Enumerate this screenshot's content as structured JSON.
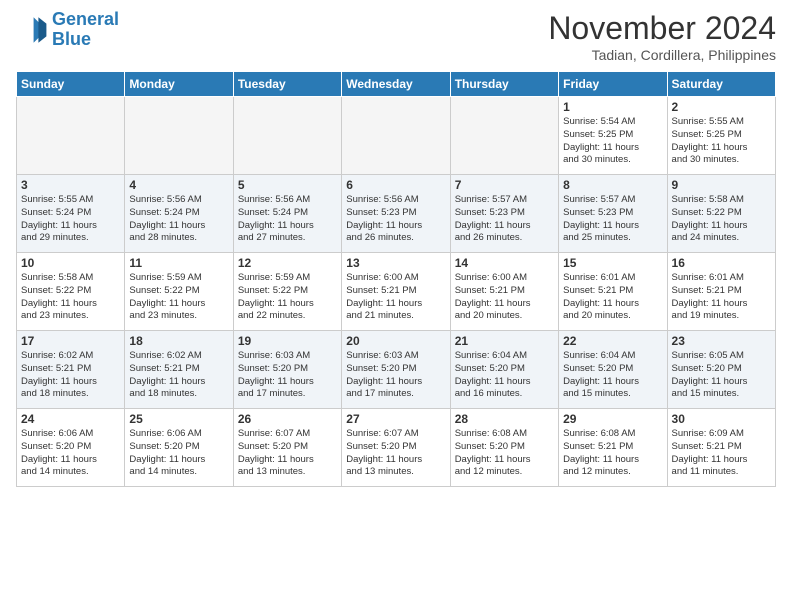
{
  "logo": {
    "line1": "General",
    "line2": "Blue"
  },
  "title": "November 2024",
  "location": "Tadian, Cordillera, Philippines",
  "weekdays": [
    "Sunday",
    "Monday",
    "Tuesday",
    "Wednesday",
    "Thursday",
    "Friday",
    "Saturday"
  ],
  "weeks": [
    [
      {
        "day": "",
        "info": ""
      },
      {
        "day": "",
        "info": ""
      },
      {
        "day": "",
        "info": ""
      },
      {
        "day": "",
        "info": ""
      },
      {
        "day": "",
        "info": ""
      },
      {
        "day": "1",
        "info": "Sunrise: 5:54 AM\nSunset: 5:25 PM\nDaylight: 11 hours\nand 30 minutes."
      },
      {
        "day": "2",
        "info": "Sunrise: 5:55 AM\nSunset: 5:25 PM\nDaylight: 11 hours\nand 30 minutes."
      }
    ],
    [
      {
        "day": "3",
        "info": "Sunrise: 5:55 AM\nSunset: 5:24 PM\nDaylight: 11 hours\nand 29 minutes."
      },
      {
        "day": "4",
        "info": "Sunrise: 5:56 AM\nSunset: 5:24 PM\nDaylight: 11 hours\nand 28 minutes."
      },
      {
        "day": "5",
        "info": "Sunrise: 5:56 AM\nSunset: 5:24 PM\nDaylight: 11 hours\nand 27 minutes."
      },
      {
        "day": "6",
        "info": "Sunrise: 5:56 AM\nSunset: 5:23 PM\nDaylight: 11 hours\nand 26 minutes."
      },
      {
        "day": "7",
        "info": "Sunrise: 5:57 AM\nSunset: 5:23 PM\nDaylight: 11 hours\nand 26 minutes."
      },
      {
        "day": "8",
        "info": "Sunrise: 5:57 AM\nSunset: 5:23 PM\nDaylight: 11 hours\nand 25 minutes."
      },
      {
        "day": "9",
        "info": "Sunrise: 5:58 AM\nSunset: 5:22 PM\nDaylight: 11 hours\nand 24 minutes."
      }
    ],
    [
      {
        "day": "10",
        "info": "Sunrise: 5:58 AM\nSunset: 5:22 PM\nDaylight: 11 hours\nand 23 minutes."
      },
      {
        "day": "11",
        "info": "Sunrise: 5:59 AM\nSunset: 5:22 PM\nDaylight: 11 hours\nand 23 minutes."
      },
      {
        "day": "12",
        "info": "Sunrise: 5:59 AM\nSunset: 5:22 PM\nDaylight: 11 hours\nand 22 minutes."
      },
      {
        "day": "13",
        "info": "Sunrise: 6:00 AM\nSunset: 5:21 PM\nDaylight: 11 hours\nand 21 minutes."
      },
      {
        "day": "14",
        "info": "Sunrise: 6:00 AM\nSunset: 5:21 PM\nDaylight: 11 hours\nand 20 minutes."
      },
      {
        "day": "15",
        "info": "Sunrise: 6:01 AM\nSunset: 5:21 PM\nDaylight: 11 hours\nand 20 minutes."
      },
      {
        "day": "16",
        "info": "Sunrise: 6:01 AM\nSunset: 5:21 PM\nDaylight: 11 hours\nand 19 minutes."
      }
    ],
    [
      {
        "day": "17",
        "info": "Sunrise: 6:02 AM\nSunset: 5:21 PM\nDaylight: 11 hours\nand 18 minutes."
      },
      {
        "day": "18",
        "info": "Sunrise: 6:02 AM\nSunset: 5:21 PM\nDaylight: 11 hours\nand 18 minutes."
      },
      {
        "day": "19",
        "info": "Sunrise: 6:03 AM\nSunset: 5:20 PM\nDaylight: 11 hours\nand 17 minutes."
      },
      {
        "day": "20",
        "info": "Sunrise: 6:03 AM\nSunset: 5:20 PM\nDaylight: 11 hours\nand 17 minutes."
      },
      {
        "day": "21",
        "info": "Sunrise: 6:04 AM\nSunset: 5:20 PM\nDaylight: 11 hours\nand 16 minutes."
      },
      {
        "day": "22",
        "info": "Sunrise: 6:04 AM\nSunset: 5:20 PM\nDaylight: 11 hours\nand 15 minutes."
      },
      {
        "day": "23",
        "info": "Sunrise: 6:05 AM\nSunset: 5:20 PM\nDaylight: 11 hours\nand 15 minutes."
      }
    ],
    [
      {
        "day": "24",
        "info": "Sunrise: 6:06 AM\nSunset: 5:20 PM\nDaylight: 11 hours\nand 14 minutes."
      },
      {
        "day": "25",
        "info": "Sunrise: 6:06 AM\nSunset: 5:20 PM\nDaylight: 11 hours\nand 14 minutes."
      },
      {
        "day": "26",
        "info": "Sunrise: 6:07 AM\nSunset: 5:20 PM\nDaylight: 11 hours\nand 13 minutes."
      },
      {
        "day": "27",
        "info": "Sunrise: 6:07 AM\nSunset: 5:20 PM\nDaylight: 11 hours\nand 13 minutes."
      },
      {
        "day": "28",
        "info": "Sunrise: 6:08 AM\nSunset: 5:20 PM\nDaylight: 11 hours\nand 12 minutes."
      },
      {
        "day": "29",
        "info": "Sunrise: 6:08 AM\nSunset: 5:21 PM\nDaylight: 11 hours\nand 12 minutes."
      },
      {
        "day": "30",
        "info": "Sunrise: 6:09 AM\nSunset: 5:21 PM\nDaylight: 11 hours\nand 11 minutes."
      }
    ]
  ]
}
